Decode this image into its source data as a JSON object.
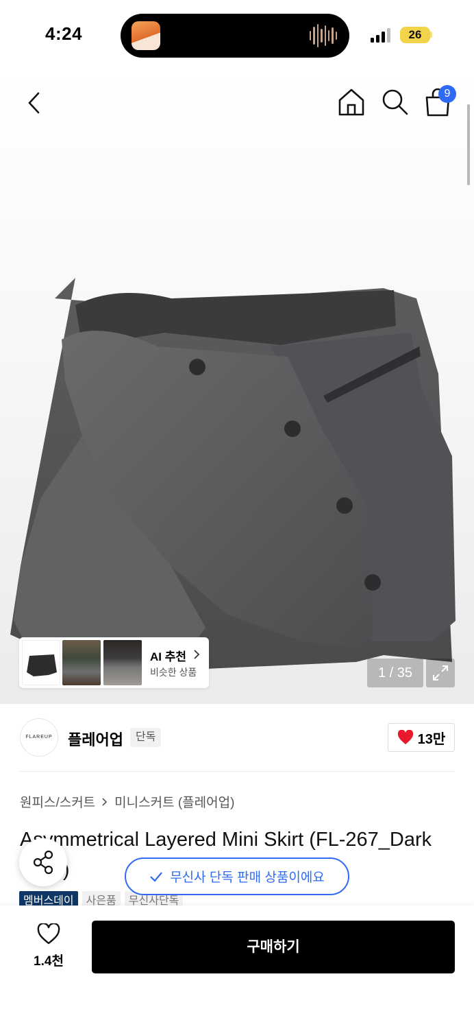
{
  "status_bar": {
    "time": "4:24",
    "battery": "26"
  },
  "nav": {
    "cart_count": "9"
  },
  "gallery": {
    "page_indicator": "1 / 35",
    "ai_recommend": {
      "title": "AI 추천",
      "subtitle": "비슷한 상품"
    }
  },
  "brand": {
    "logo_text": "FLAREUP",
    "name": "플레어업",
    "tag": "단독",
    "likes": "13만"
  },
  "breadcrumb": {
    "level1": "원피스/스커트",
    "level2": "미니스커트 (플레어업)"
  },
  "product": {
    "title": "Asymmetrical Layered Mini Skirt (FL-267_Dark Gray)"
  },
  "toast": {
    "text": "무신사 단독 판매 상품이에요"
  },
  "badges": [
    "멤버스데이",
    "사은품",
    "무신사단독"
  ],
  "bottom": {
    "wish_count": "1.4천",
    "buy_label": "구매하기"
  },
  "colors": {
    "accent": "#2f6af5",
    "member_badge": "#0f3766",
    "heart": "#e8192c"
  }
}
